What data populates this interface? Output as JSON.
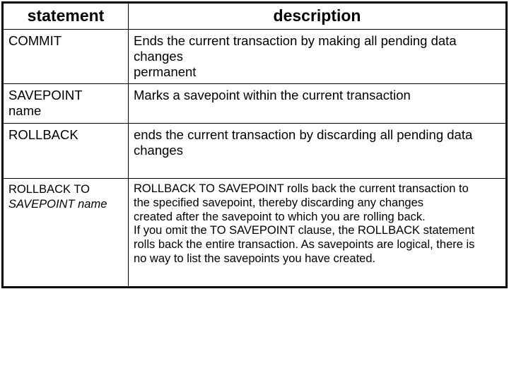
{
  "headers": {
    "statement": "statement",
    "description": "description"
  },
  "rows": [
    {
      "statement_parts": [
        {
          "text": "COMMIT",
          "italic": false
        }
      ],
      "description": "Ends the current transaction by making all pending data changes\npermanent",
      "small": false
    },
    {
      "statement_parts": [
        {
          "text": "SAVEPOINT ",
          "italic": false
        },
        {
          "text": "name",
          "italic": false
        }
      ],
      "statement_break_after_first": true,
      "description": "Marks a savepoint within the current transaction",
      "small": false
    },
    {
      "statement_parts": [
        {
          "text": "ROLLBACK",
          "italic": false
        }
      ],
      "description": "ends the current transaction by discarding all pending data changes",
      "small": false,
      "extra_bottom": true
    },
    {
      "statement_parts": [
        {
          "text": "ROLLBACK TO",
          "italic": false
        },
        {
          "text": " SAVEPOINT name",
          "italic": true
        }
      ],
      "statement_break_after_first": true,
      "description": "ROLLBACK TO SAVEPOINT rolls back the current transaction to\nthe specified savepoint, thereby discarding any changes\ncreated after the savepoint to which you are rolling back.\nIf you omit the  TO SAVEPOINT clause, the ROLLBACK statement\nrolls back the entire transaction. As savepoints are logical, there is\nno way to list the savepoints you have created.",
      "small": true,
      "extra_bottom": true
    }
  ]
}
